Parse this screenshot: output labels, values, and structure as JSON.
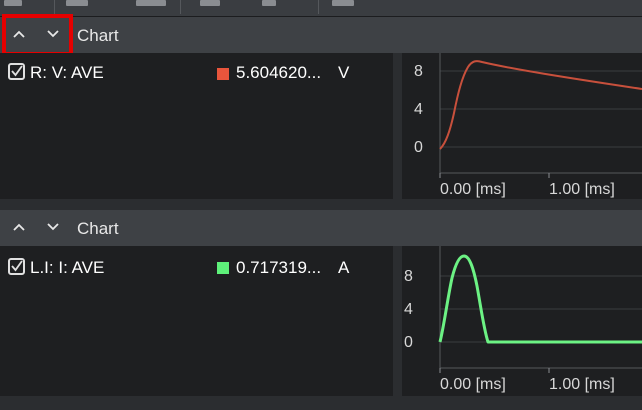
{
  "toolbar": {
    "icons": [
      "toolbar-tool-icon",
      "toolbar-tool-icon",
      "toolbar-tool-icon",
      "toolbar-tool-icon",
      "toolbar-tool-icon",
      "toolbar-tool-icon"
    ]
  },
  "panels": [
    {
      "title": "Chart",
      "collapse_icon": "chevron-up-icon",
      "expand_icon": "chevron-down-icon",
      "signal": {
        "checked": true,
        "name": "R: V: AVE",
        "color": "#e8553c",
        "value": "5.604620...",
        "unit": "V"
      },
      "chart": {
        "y_ticks": [
          "8",
          "4",
          "0"
        ],
        "x_ticks": [
          "0.00 [ms]",
          "1.00 [ms]"
        ],
        "line_color": "#c8503c"
      }
    },
    {
      "title": "Chart",
      "collapse_icon": "chevron-up-icon",
      "expand_icon": "chevron-down-icon",
      "signal": {
        "checked": true,
        "name": "L.I: I: AVE",
        "color": "#5ef07a",
        "value": "0.717319...",
        "unit": "A"
      },
      "chart": {
        "y_ticks": [
          "8",
          "4",
          "0"
        ],
        "x_ticks": [
          "0.00 [ms]",
          "1.00 [ms]"
        ],
        "line_color": "#6cf284"
      }
    }
  ]
}
